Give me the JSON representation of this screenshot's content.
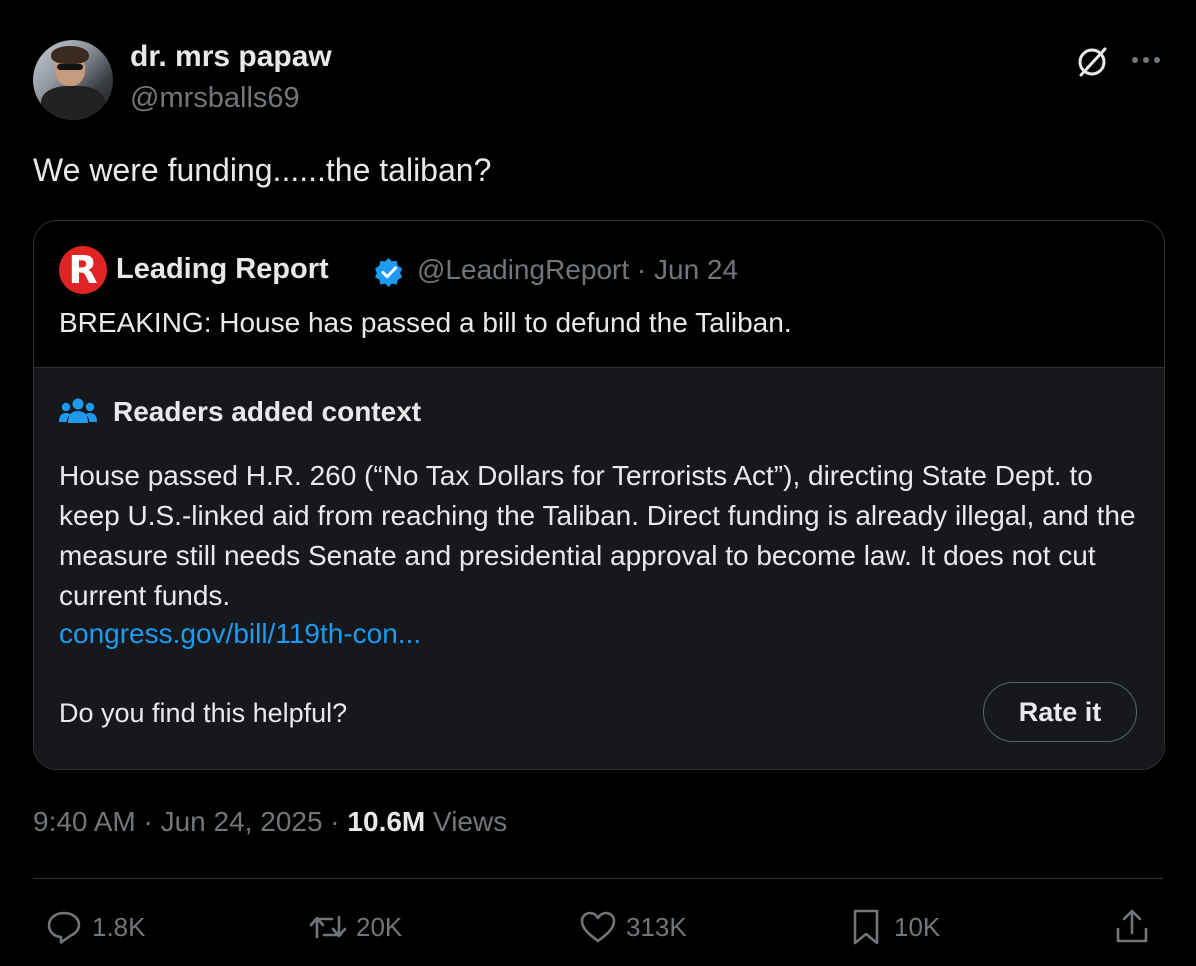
{
  "author": {
    "display_name": "dr. mrs papaw",
    "handle": "@mrsballs69"
  },
  "tweet": {
    "text": "We were funding......the taliban?"
  },
  "quote": {
    "logo_letter": "R",
    "name": "Leading Report",
    "handle_date": "@LeadingReport · Jun 24",
    "text": "BREAKING: House has passed a bill to defund the Taliban."
  },
  "context": {
    "title": "Readers added context",
    "body": "House passed H.R. 260 (“No Tax Dollars for Terrorists Act”), directing State Dept. to keep U.S.-linked aid from reaching the Taliban. Direct funding is already illegal, and the measure still needs Senate and presidential approval to become law. It does not cut current funds.",
    "link": "congress.gov/bill/119th-con...",
    "helpful_question": "Do you find this helpful?",
    "rate_label": "Rate it"
  },
  "meta": {
    "time_date": "9:40 AM · Jun 24, 2025 · ",
    "views_count": "10.6M",
    "views_label": " Views"
  },
  "actions": {
    "replies": "1.8K",
    "reposts": "20K",
    "likes": "313K",
    "bookmarks": "10K"
  },
  "colors": {
    "background": "#000000",
    "text": "#e7e9ea",
    "muted": "#71767b",
    "link": "#1d9bf0",
    "verified": "#1d9bf0",
    "brand_red": "#e02424",
    "context_bg": "#16181c"
  },
  "icons": [
    "grok-icon",
    "more-icon",
    "verified-icon",
    "people-icon",
    "reply-icon",
    "retweet-icon",
    "like-icon",
    "bookmark-icon",
    "share-icon"
  ]
}
